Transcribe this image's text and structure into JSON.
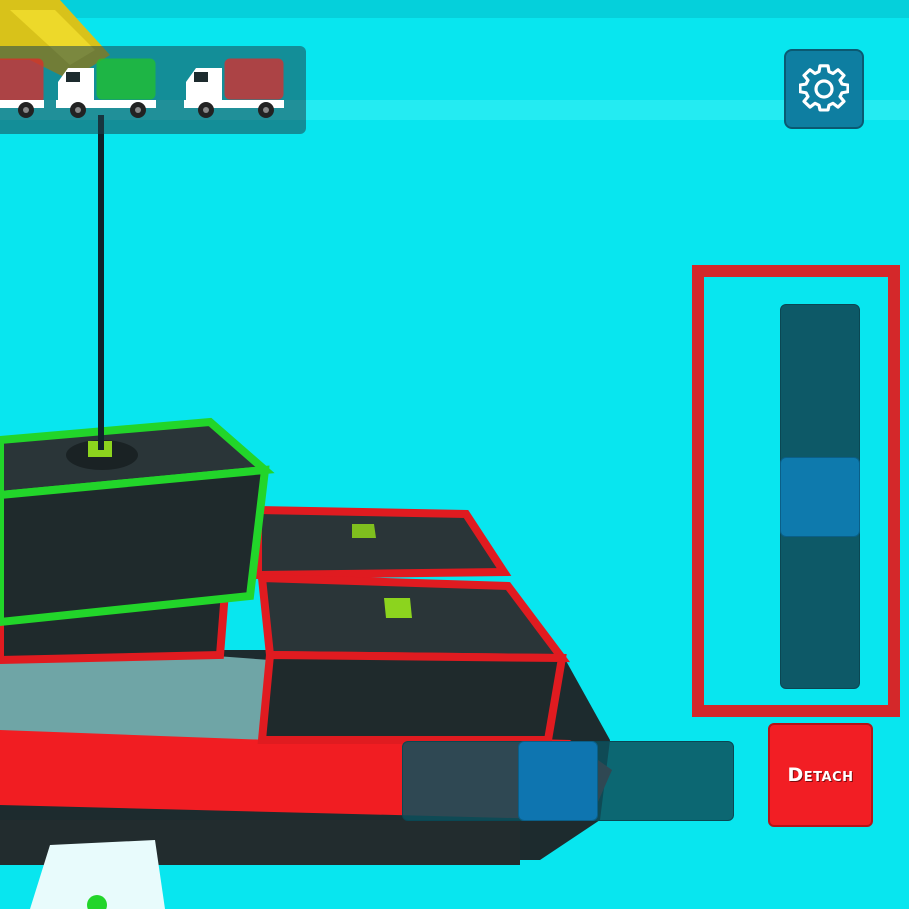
{
  "hud": {
    "trucks": [
      {
        "name": "truck-red-partial",
        "cargo_color": "#e02a2a"
      },
      {
        "name": "truck-green",
        "cargo_color": "#22c22a"
      },
      {
        "name": "truck-red",
        "cargo_color": "#e02a2a"
      }
    ],
    "settings_icon": "gear-icon"
  },
  "controls": {
    "vertical_slider": {
      "value": 0.5
    },
    "horizontal_slider": {
      "value": 0.46
    },
    "detach_label": "Detach"
  },
  "colors": {
    "water": "#08e6ef",
    "highlight_frame": "#d4282a",
    "detach_button": "#f21e24",
    "selected_container": "#22d52a",
    "other_container": "#e01b20"
  }
}
